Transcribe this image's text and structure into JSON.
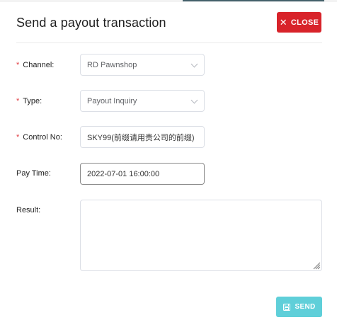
{
  "dialog": {
    "title": "Send a payout transaction",
    "close_label": "CLOSE"
  },
  "form": {
    "channel": {
      "label": "Channel:",
      "required": true,
      "value": "RD Pawnshop"
    },
    "type": {
      "label": "Type:",
      "required": true,
      "value": "Payout Inquiry"
    },
    "control_no": {
      "label": "Control No:",
      "required": true,
      "value": "SKY99(前缀请用贵公司的前缀)"
    },
    "pay_time": {
      "label": "Pay Time:",
      "required": false,
      "value": "2022-07-01 16:00:00"
    },
    "result": {
      "label": "Result:",
      "required": false,
      "value": ""
    }
  },
  "footer": {
    "send_label": "SEND"
  },
  "colors": {
    "close": "#d8232a",
    "send": "#5fcfd9",
    "required": "#e0383e"
  }
}
